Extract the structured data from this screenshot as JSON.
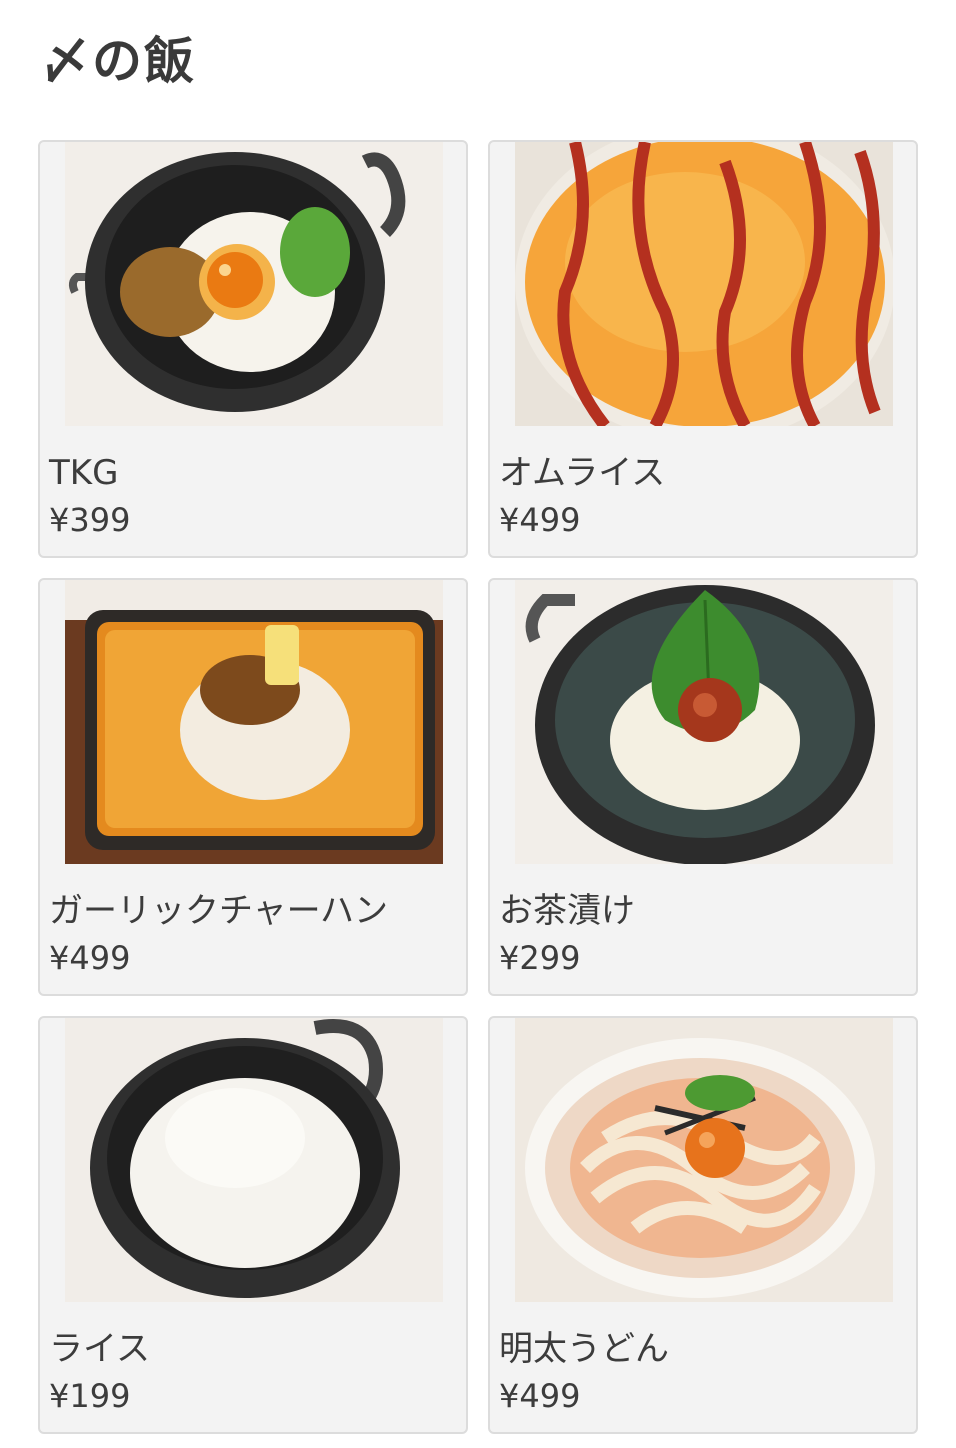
{
  "section": {
    "title": "〆の飯"
  },
  "items": [
    {
      "name": "TKG",
      "price": "¥399",
      "photo": "tkg-rice-bowl"
    },
    {
      "name": "オムライス",
      "price": "¥499",
      "photo": "omurice"
    },
    {
      "name": "ガーリックチャーハン",
      "price": "¥499",
      "photo": "garlic-fried-rice"
    },
    {
      "name": "お茶漬け",
      "price": "¥299",
      "photo": "ochazuke"
    },
    {
      "name": "ライス",
      "price": "¥199",
      "photo": "plain-rice"
    },
    {
      "name": "明太うどん",
      "price": "¥499",
      "photo": "mentai-udon"
    }
  ],
  "colors": {
    "card_background": "#f3f3f3",
    "card_border": "#dcdcdc",
    "text": "#3c3c3c"
  }
}
